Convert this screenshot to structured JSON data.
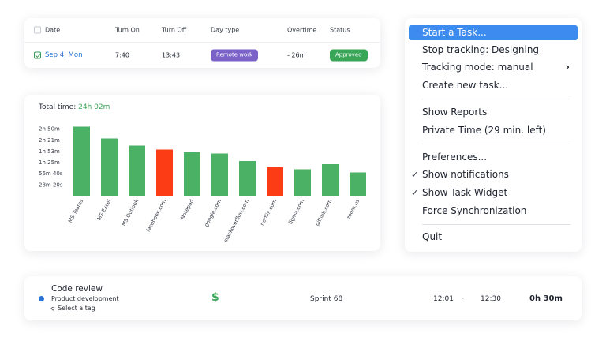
{
  "table": {
    "headers": {
      "date": "Date",
      "turn_on": "Turn On",
      "turn_off": "Turn Off",
      "day_type": "Day type",
      "overtime": "Overtime",
      "status": "Status"
    },
    "row": {
      "date": "Sep 4, Mon",
      "turn_on": "7:40",
      "turn_off": "13:43",
      "day_type": "Remote work",
      "overtime": "- 26m",
      "status": "Approved"
    }
  },
  "chart": {
    "total_label": "Total time:",
    "total_value": "24h 02m"
  },
  "chart_data": {
    "type": "bar",
    "categories": [
      "MS Teams",
      "MS Excel",
      "MS Outlook",
      "facebook.com",
      "Notepad",
      "google.com",
      "stackoverflow.com",
      "netflix.com",
      "figma.com",
      "github.com",
      "zoom.us"
    ],
    "values": [
      175,
      145,
      127,
      117,
      111,
      107,
      88,
      72,
      67,
      80,
      59
    ],
    "y_ticks": [
      {
        "label": "2h 50m",
        "value": 170
      },
      {
        "label": "2h 21m",
        "value": 141
      },
      {
        "label": "1h 53m",
        "value": 113
      },
      {
        "label": "1h 25m",
        "value": 85
      },
      {
        "label": "56m 40s",
        "value": 56.67
      },
      {
        "label": "28m 20s",
        "value": 28.33
      }
    ],
    "y_unit": "minutes",
    "ylim": [
      0,
      176
    ],
    "grid": false,
    "colors": {
      "normal": "#4bb265",
      "distracting": "#fb3c14"
    },
    "bar_colors": [
      "#4bb265",
      "#4bb265",
      "#4bb265",
      "#fb3c14",
      "#4bb265",
      "#4bb265",
      "#4bb265",
      "#fb3c14",
      "#4bb265",
      "#4bb265",
      "#4bb265"
    ]
  },
  "menu": {
    "items": [
      {
        "label": "Start a Task...",
        "active": true
      },
      {
        "label": "Stop tracking: Designing"
      },
      {
        "label": "Tracking mode: manual",
        "submenu": "›"
      },
      {
        "label": "Create new task..."
      },
      {
        "label": "Show Reports"
      },
      {
        "label": "Private Time (29 min. left)"
      },
      {
        "label": "Preferences..."
      },
      {
        "label": "Show notifications",
        "check": "✓"
      },
      {
        "label": "Show Task Widget",
        "check": "✓"
      },
      {
        "label": "Force Synchronization"
      },
      {
        "label": "Quit"
      }
    ]
  },
  "task": {
    "title": "Code review",
    "project": "Product development",
    "tag": "Select a tag",
    "billable_symbol": "$",
    "sprint": "Sprint 68",
    "start": "12:01",
    "dash": "-",
    "end": "12:30",
    "duration": "0h 30m"
  },
  "colors": {
    "accent_blue": "#3d8bee",
    "green": "#38a557",
    "purple": "#7b62c9",
    "link_blue": "#2470d4"
  }
}
